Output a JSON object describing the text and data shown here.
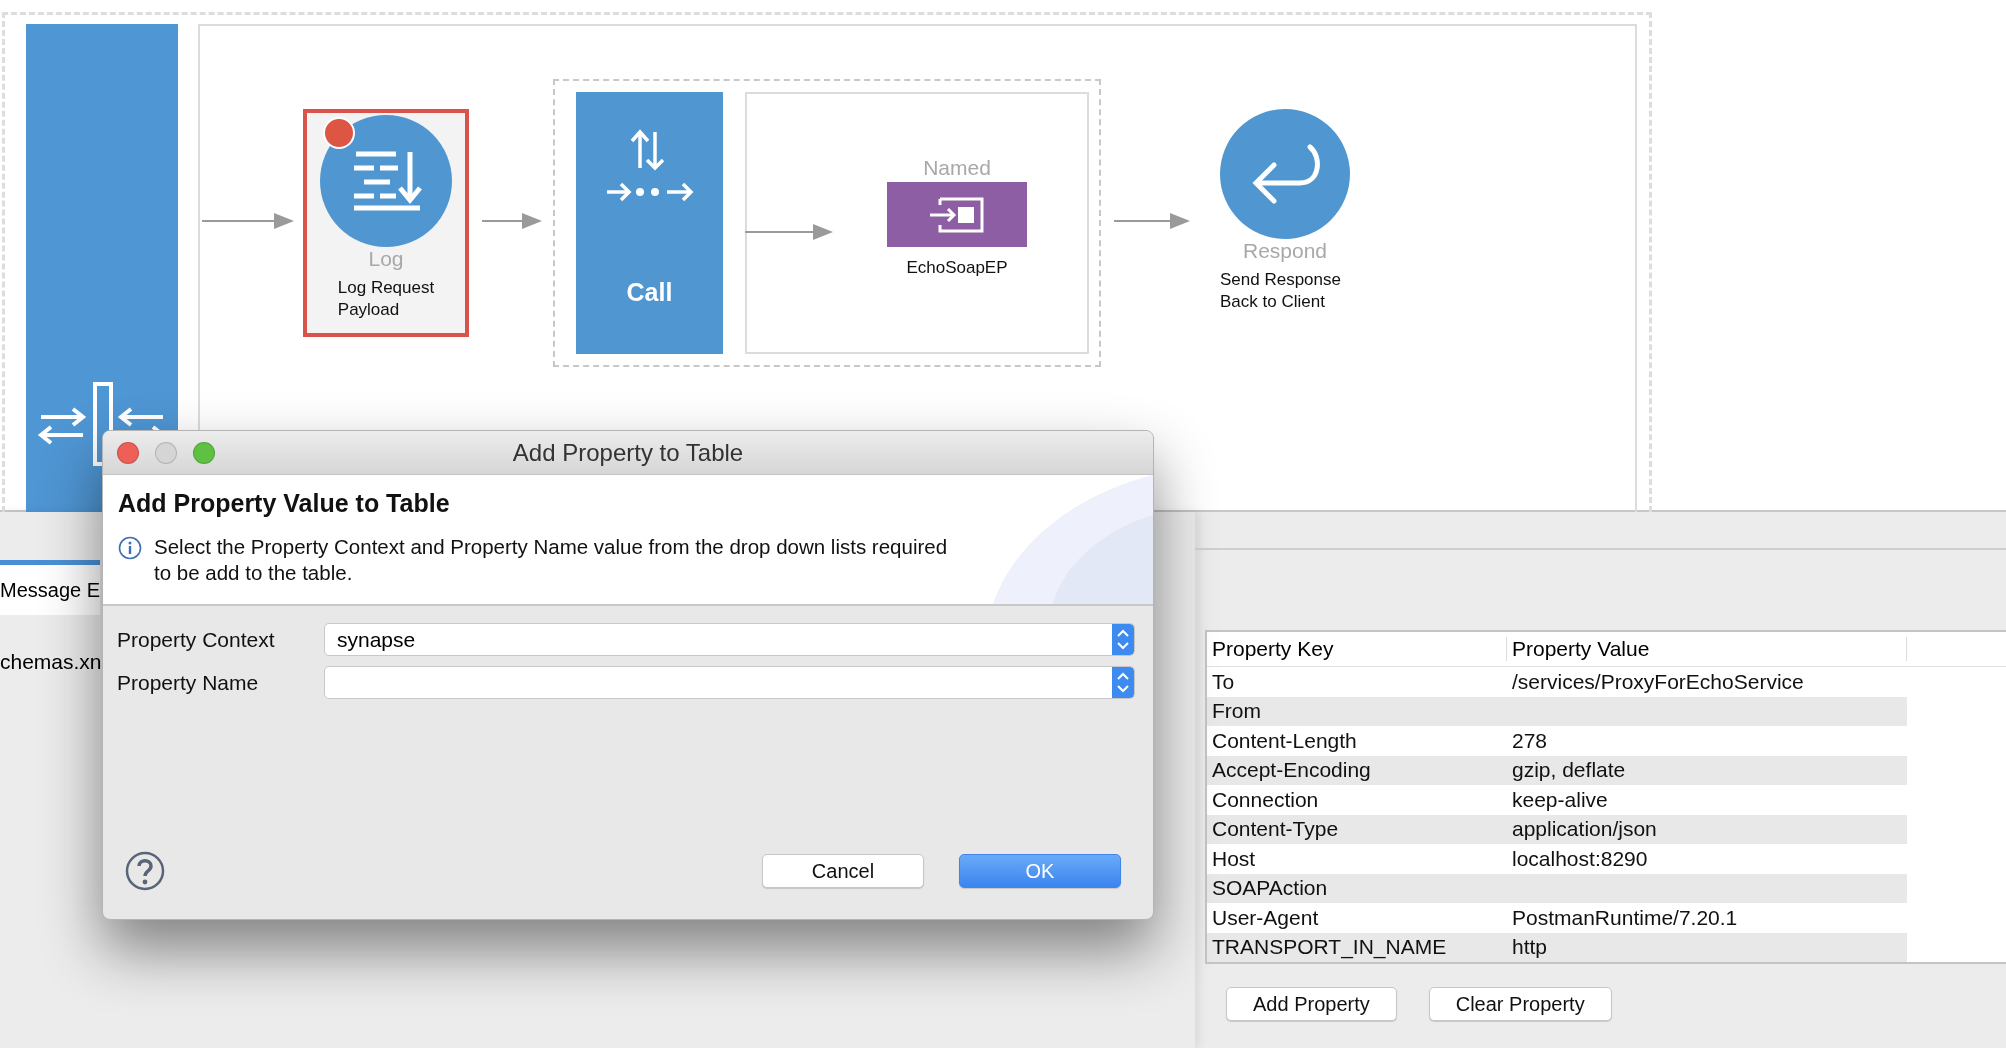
{
  "canvas": {
    "nodes": [
      {
        "kind": "log",
        "type_label": "Log",
        "description": [
          "Log Request",
          "Payload"
        ],
        "selected": true,
        "breakpoint": true
      },
      {
        "kind": "call",
        "label": "Call"
      },
      {
        "kind": "endpoint",
        "type_label": "Named",
        "name": "EchoSoapEP"
      },
      {
        "kind": "respond",
        "type_label": "Respond",
        "description": [
          "Send Response",
          "Back to Client"
        ]
      }
    ]
  },
  "left_panel": {
    "tabs": [
      {
        "label": "Message E",
        "selected": true
      }
    ],
    "items": [
      "chemas.xn"
    ]
  },
  "dialog": {
    "title": "Add Property to Table",
    "heading": "Add Property Value to Table",
    "message": "Select the Property Context and Property Name value from the drop down lists required to be add to the table.",
    "fields": [
      {
        "label": "Property Context",
        "value": "synapse"
      },
      {
        "label": "Property Name"
      }
    ],
    "buttons": [
      {
        "label": "Cancel",
        "default": false
      },
      {
        "label": "OK",
        "default": true
      }
    ]
  },
  "properties_table": {
    "columns": [
      "Property Key",
      "Property Value"
    ],
    "rows": [
      {
        "key": "To",
        "value": "/services/ProxyForEchoService"
      },
      {
        "key": "From"
      },
      {
        "key": "Content-Length",
        "value": "278"
      },
      {
        "key": "Accept-Encoding",
        "value": "gzip, deflate"
      },
      {
        "key": "Connection",
        "value": "keep-alive"
      },
      {
        "key": "Content-Type",
        "value": "application/json"
      },
      {
        "key": "Host",
        "value": "localhost:8290"
      },
      {
        "key": "SOAPAction"
      },
      {
        "key": "User-Agent",
        "value": "PostmanRuntime/7.20.1"
      },
      {
        "key": "TRANSPORT_IN_NAME",
        "value": "http"
      }
    ]
  },
  "actions": [
    "Add Property",
    "Clear Property"
  ]
}
